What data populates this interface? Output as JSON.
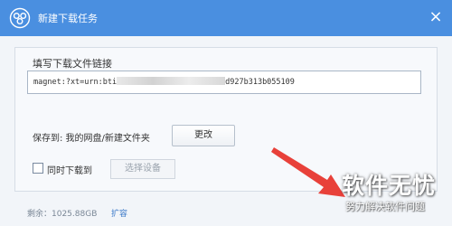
{
  "window": {
    "title": "新建下载任务",
    "accent_color": "#4a8fe0",
    "logo_icon": "cloud-logo-icon",
    "close_symbol": "×"
  },
  "form": {
    "link_label": "填写下载文件链接",
    "link_prefix": "magnet:?xt=urn:bti",
    "link_suffix": "d927b313b055109",
    "save_label": "保存到: 我的网盘/新建文件夹",
    "change_button": "更改",
    "sync_label": "同时下载到",
    "sync_checked": false,
    "select_device_button": "选择设备"
  },
  "footer": {
    "remaining": "剩余：1025.88GB",
    "expand_link": "扩容"
  },
  "watermark": {
    "title": "软件无忧",
    "subtitle": "努力解决软件问题",
    "arrow_color": "#e8413a"
  }
}
